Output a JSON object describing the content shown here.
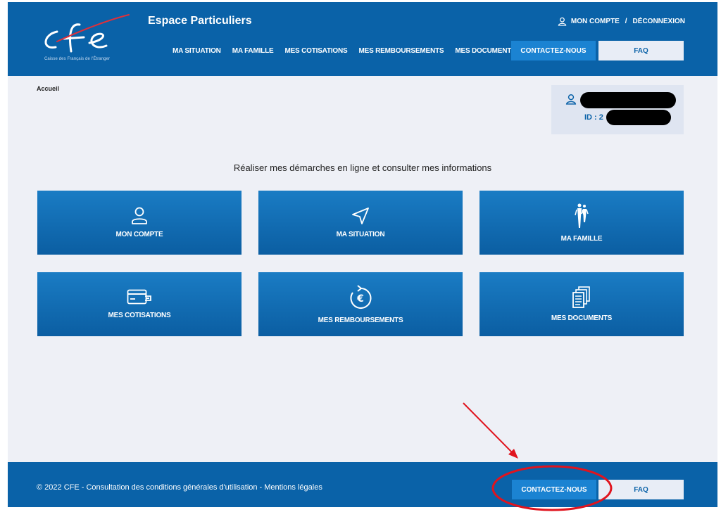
{
  "header": {
    "app_title": "Espace Particuliers",
    "logo_text": "cfe",
    "logo_tagline": "Caisse des Français de l'Étranger",
    "account_label": "MON COMPTE",
    "separator": "/",
    "logout_label": "DÉCONNEXION",
    "nav": [
      {
        "label": "MA SITUATION"
      },
      {
        "label": "MA FAMILLE"
      },
      {
        "label": "MES COTISATIONS"
      },
      {
        "label": "MES REMBOURSEMENTS"
      },
      {
        "label": "MES DOCUMENTS"
      }
    ],
    "contact_label": "CONTACTEZ-NOUS",
    "faq_label": "FAQ"
  },
  "breadcrumb": "Accueil",
  "user_card": {
    "id_label": "ID : 2"
  },
  "main": {
    "section_title": "Réaliser mes démarches en ligne et consulter mes informations",
    "tiles": [
      {
        "label": "MON COMPTE",
        "icon": "user-icon"
      },
      {
        "label": "MA SITUATION",
        "icon": "navigation-icon"
      },
      {
        "label": "MA FAMILLE",
        "icon": "family-icon"
      },
      {
        "label": "MES COTISATIONS",
        "icon": "payment-card-icon"
      },
      {
        "label": "MES REMBOURSEMENTS",
        "icon": "euro-refresh-icon"
      },
      {
        "label": "MES DOCUMENTS",
        "icon": "documents-icon"
      }
    ]
  },
  "footer": {
    "text": "© 2022 CFE - Consultation des conditions générales d'utilisation - Mentions légales",
    "contact_label": "CONTACTEZ-NOUS",
    "faq_label": "FAQ"
  },
  "colors": {
    "brand_blue": "#0a62a8",
    "button_blue": "#1b83d2",
    "annotation_red": "#e0141e",
    "background": "#eef0f6"
  }
}
